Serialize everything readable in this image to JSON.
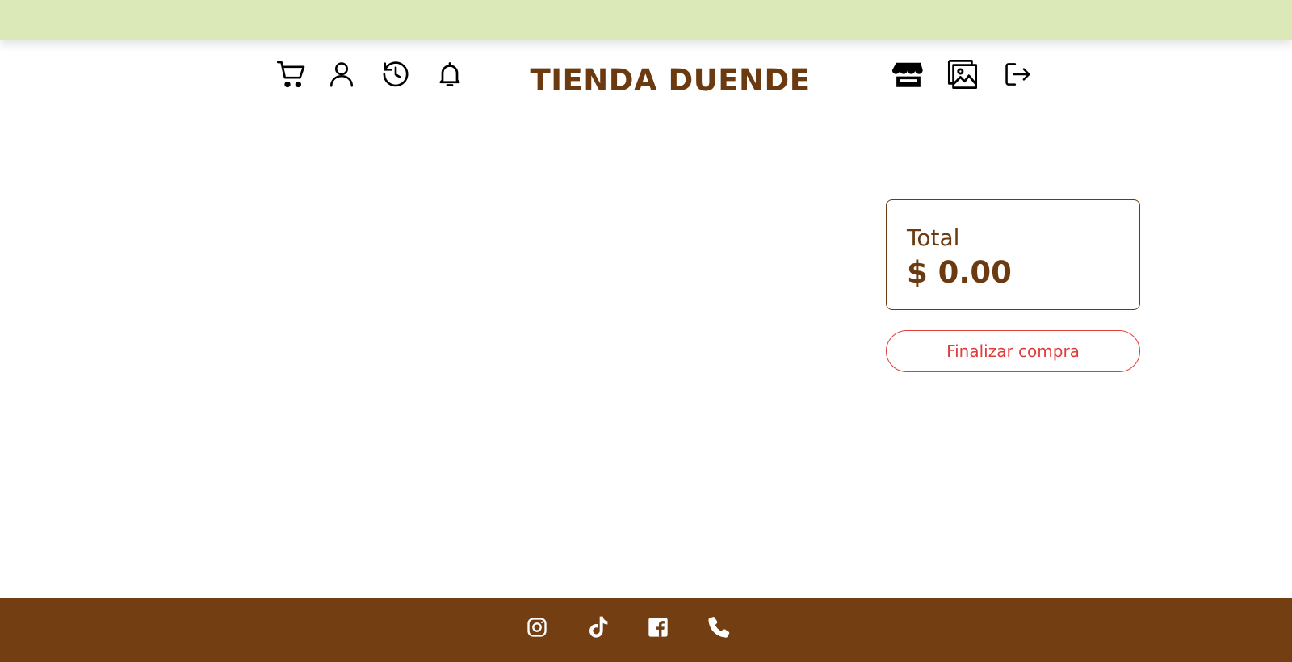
{
  "colors": {
    "banner": "#dbe9b9",
    "brand": "#6b3a10",
    "accent": "#e23b3b",
    "footer": "#733e12"
  },
  "header": {
    "brand": "TIENDA DUENDE",
    "left_icons": [
      "cart-icon",
      "user-icon",
      "history-icon",
      "bell-icon"
    ],
    "right_icons": [
      "store-icon",
      "gallery-icon",
      "logout-icon"
    ]
  },
  "summary": {
    "total_label": "Total",
    "total_value": "$ 0.00",
    "checkout_label": "Finalizar compra"
  },
  "footer": {
    "social_icons": [
      "instagram-icon",
      "tiktok-icon",
      "facebook-icon",
      "phone-icon"
    ]
  }
}
